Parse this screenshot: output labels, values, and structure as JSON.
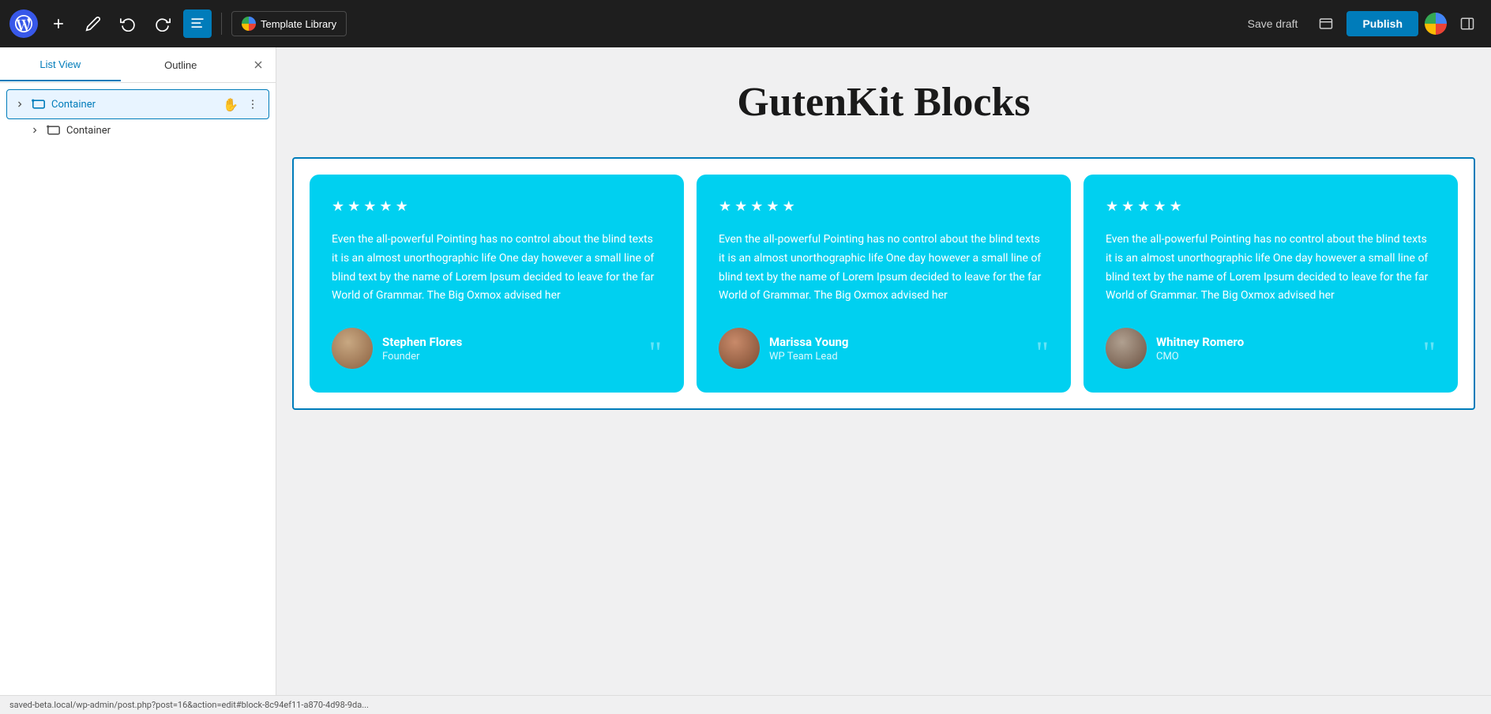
{
  "toolbar": {
    "wp_logo_label": "WordPress",
    "add_button_label": "Add new block",
    "pencil_button_label": "Tools",
    "undo_button_label": "Undo",
    "redo_button_label": "Redo",
    "document_overview_label": "Document Overview",
    "template_library_label": "Template Library",
    "save_draft_label": "Save draft",
    "publish_label": "Publish",
    "preview_label": "Preview",
    "toggle_sidebar_label": "Toggle sidebar"
  },
  "sidebar": {
    "tab_list_view": "List View",
    "tab_outline": "Outline",
    "close_label": "Close",
    "items": [
      {
        "label": "Container",
        "selected": true,
        "level": 0
      },
      {
        "label": "Container",
        "selected": false,
        "level": 1
      }
    ]
  },
  "content": {
    "page_title": "GutenKit Blocks",
    "testimonials": [
      {
        "stars": 5,
        "text": "Even the all-powerful Pointing has no control about the blind texts it is an almost unorthographic life One day however a small line of blind text by the name of Lorem Ipsum decided to leave for the far World of Grammar. The Big Oxmox advised her",
        "name": "Stephen Flores",
        "role": "Founder"
      },
      {
        "stars": 5,
        "text": "Even the all-powerful Pointing has no control about the blind texts it is an almost unorthographic life One day however a small line of blind text by the name of Lorem Ipsum decided to leave for the far World of Grammar. The Big Oxmox advised her",
        "name": "Marissa Young",
        "role": "WP Team Lead"
      },
      {
        "stars": 5,
        "text": "Even the all-powerful Pointing has no control about the blind texts it is an almost unorthographic life One day however a small line of blind text by the name of Lorem Ipsum decided to leave for the far World of Grammar. The Big Oxmox advised her",
        "name": "Whitney Romero",
        "role": "CMO"
      }
    ]
  },
  "status_bar": {
    "url": "saved-beta.local/wp-admin/post.php?post=16&action=edit#block-8c94ef11-a870-4d98-9da..."
  }
}
